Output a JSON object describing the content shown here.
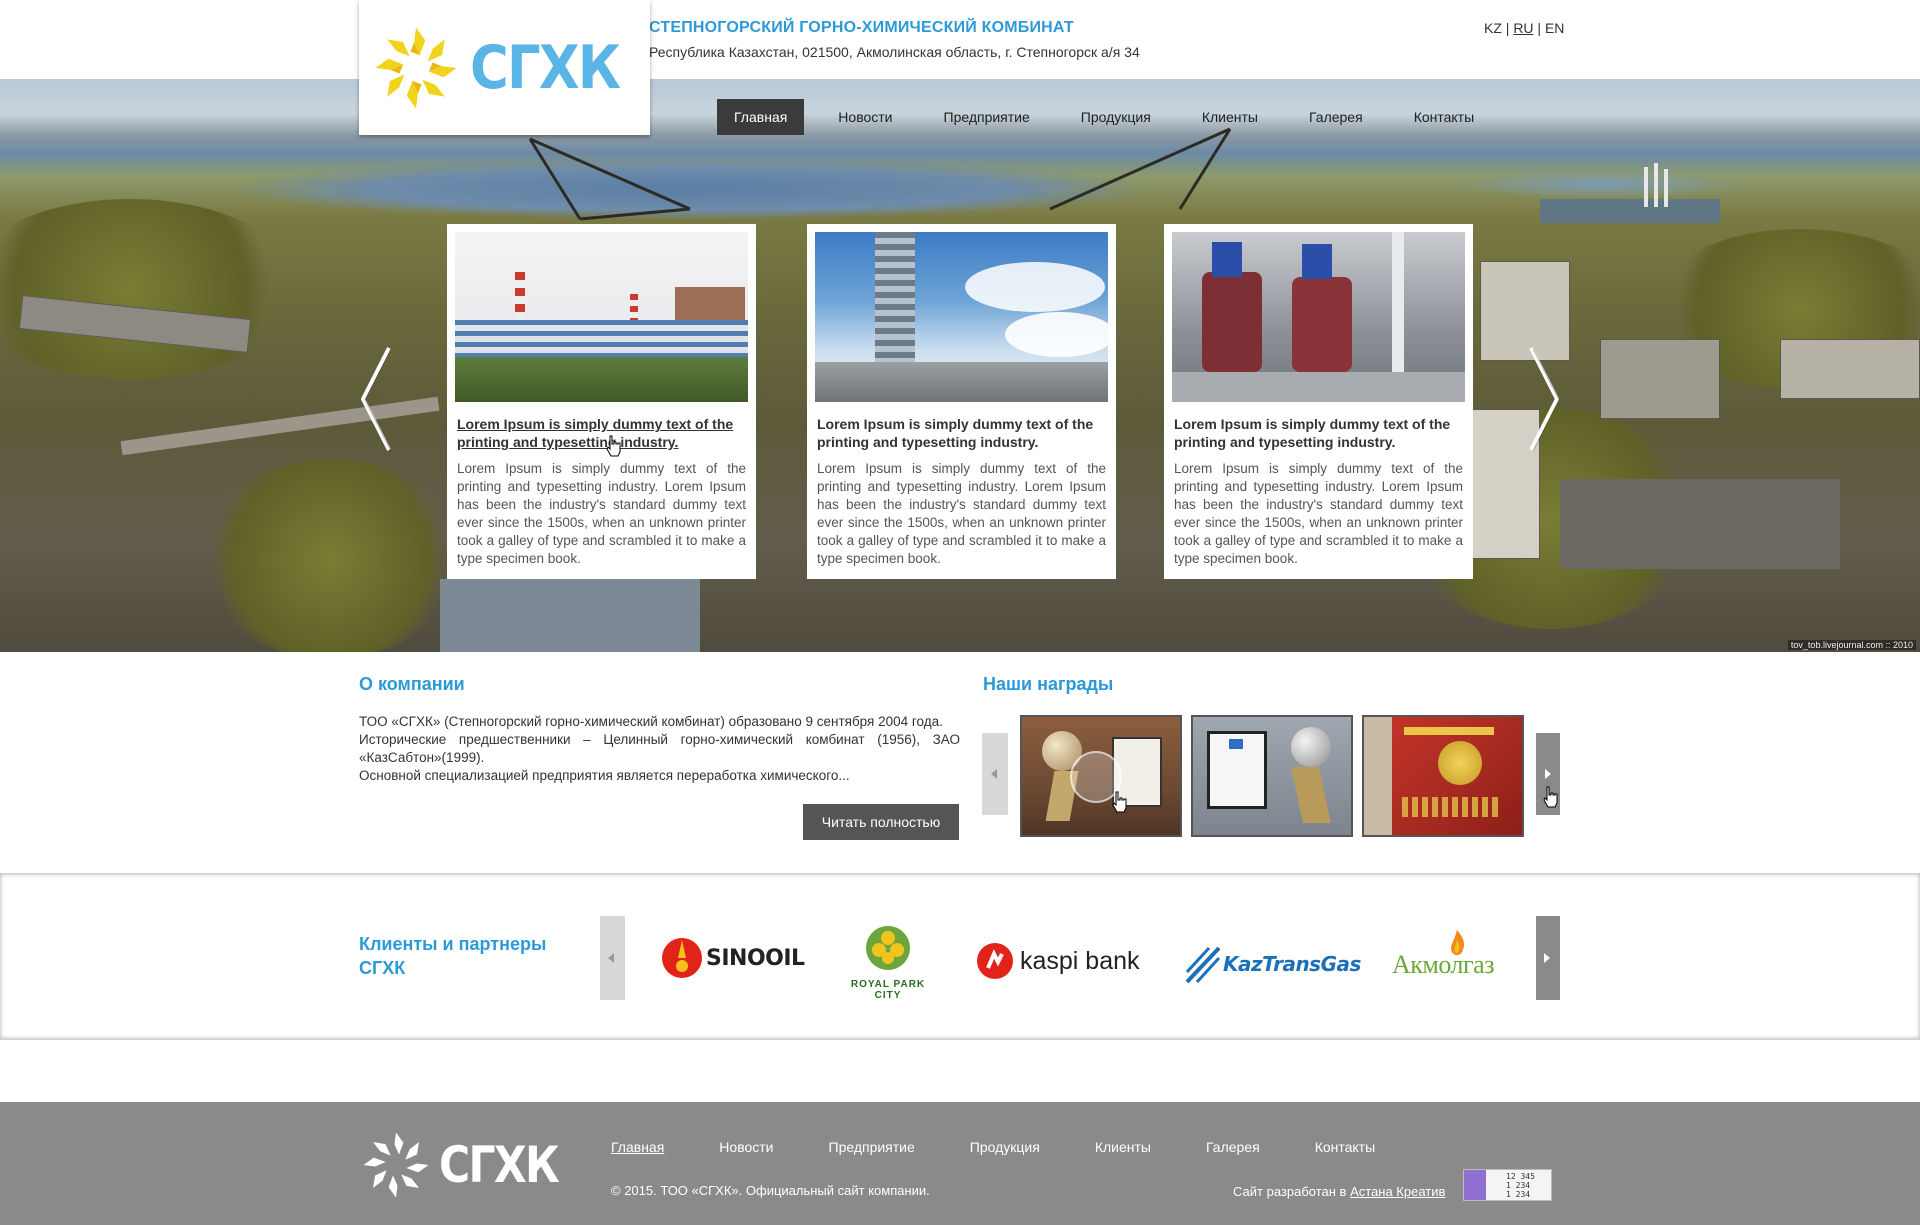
{
  "header": {
    "logo_text": "СГХК",
    "company_name": "СТЕПНОГОРСКИЙ ГОРНО-ХИМИЧЕСКИЙ КОМБИНАТ",
    "address": "Республика Казахстан, 021500, Акмолинская область, г. Степногорск а/я 34",
    "languages": [
      "KZ",
      "RU",
      "EN"
    ],
    "active_language": "RU"
  },
  "nav": {
    "items": [
      "Главная",
      "Новости",
      "Предприятие",
      "Продукция",
      "Клиенты",
      "Галерея",
      "Контакты"
    ],
    "active": "Главная"
  },
  "hero": {
    "photo_credit": "tov_tob.livejournal.com :: 2010",
    "cards": [
      {
        "title": "Lorem Ipsum is simply dummy text of the printing and typesetting industry.",
        "text": "Lorem Ipsum is simply dummy text of the printing and typesetting industry. Lorem Ipsum has been the industry's standard dummy text ever since the 1500s, when an unknown printer took a galley of type and scrambled it to make a type specimen book."
      },
      {
        "title": "Lorem Ipsum is simply dummy text of the printing and typesetting industry.",
        "text": "Lorem Ipsum is simply dummy text of the printing and typesetting industry. Lorem Ipsum has been the industry's standard dummy text ever since the 1500s, when an unknown printer took a galley of type and scrambled it to make a type specimen book."
      },
      {
        "title": "Lorem Ipsum is simply dummy text of the printing and typesetting industry.",
        "text": "Lorem Ipsum is simply dummy text of the printing and typesetting industry. Lorem Ipsum has been the industry's standard dummy text ever since the 1500s, when an unknown printer took a galley of type and scrambled it to make a type specimen book."
      }
    ]
  },
  "about": {
    "title": "О компании",
    "text_lines": [
      "ТОО «СГХК» (Степногорский горно-химический комбинат) образовано 9 сентября 2004 года.",
      "Исторические предшественники – Целинный горно-химический комбинат (1956), ЗАО «КазСабтон»(1999).",
      "Основной специализацией предприятия является переработка химического..."
    ],
    "read_more": "Читать полностью"
  },
  "awards": {
    "title": "Наши награды"
  },
  "partners": {
    "title": "Клиенты и партнеры СГХК",
    "logos": [
      "SINOOIL",
      "ROYAL PARK CITY",
      "kaspi bank",
      "KazTransGas",
      "Акмолгаз"
    ]
  },
  "footer": {
    "logo_text": "СГХК",
    "nav": [
      "Главная",
      "Новости",
      "Предприятие",
      "Продукция",
      "Клиенты",
      "Галерея",
      "Контакты"
    ],
    "copyright": "© 2015. ТОО «СГХК».  Официальный сайт компании.",
    "developer_prefix": "Сайт разработан в ",
    "developer_link": "Астана Креатив",
    "counter": [
      "12 345",
      "1 234",
      "1 234"
    ]
  },
  "colors": {
    "brand_blue": "#2c9ad8",
    "logo_blue": "#5ab4e6",
    "logo_yellow": "#f2d21a",
    "footer_gray": "#8a8a8a",
    "nav_active": "#3b3b3b"
  }
}
